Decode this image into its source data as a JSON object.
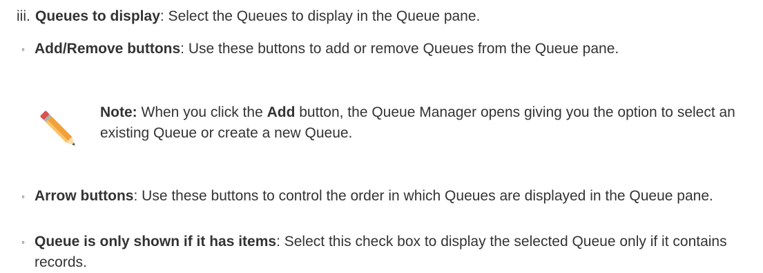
{
  "list": {
    "roman_marker": "iii.",
    "roman_title": "Queues to display",
    "roman_text": ": Select the Queues to display in the Queue pane.",
    "bullet_marker": "◦",
    "items": [
      {
        "title": "Add/Remove buttons",
        "text": ": Use these buttons to add or remove Queues from the Queue pane."
      },
      {
        "title": "Arrow buttons",
        "text": ": Use these buttons to control the order in which Queues are displayed in the Queue pane."
      },
      {
        "title": "Queue is only shown if it has items",
        "text": ": Select this check box to display the selected Queue only if it contains records."
      }
    ]
  },
  "note": {
    "icon": "pencil-icon",
    "label": "Note:",
    "text_before": " When you click the ",
    "button_word": "Add",
    "text_after": " button, the Queue Manager opens giving you the option to select an existing Queue or create a new Queue."
  },
  "colors": {
    "text": "#333333",
    "pencil_body": "#f2a13a",
    "pencil_eraser": "#d9534f"
  }
}
